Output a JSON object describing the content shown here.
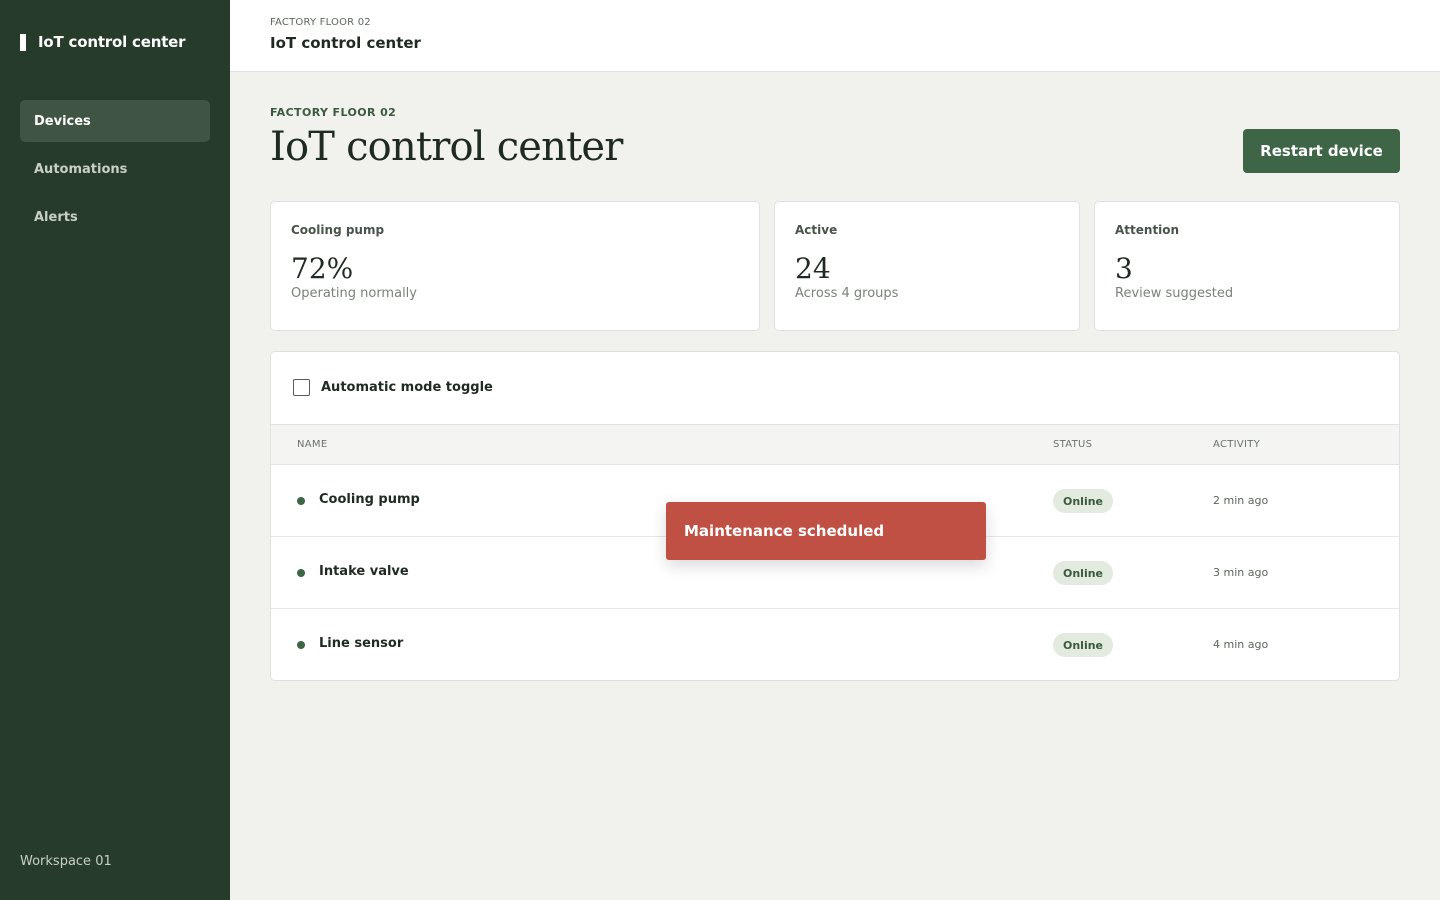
{
  "app": {
    "brand": "IoT control center",
    "workspace": "Workspace 01"
  },
  "sidebar": {
    "items": [
      {
        "label": "Devices",
        "active": true
      },
      {
        "label": "Automations",
        "active": false
      },
      {
        "label": "Alerts",
        "active": false
      }
    ]
  },
  "topbar": {
    "eyebrow": "FACTORY FLOOR 02",
    "title": "IoT control center"
  },
  "header": {
    "eyebrow": "FACTORY FLOOR 02",
    "title": "IoT control center",
    "primary_action": "Restart device"
  },
  "stats": [
    {
      "label": "Cooling pump",
      "value": "72%",
      "sub": "Operating normally"
    },
    {
      "label": "Active",
      "value": "24",
      "sub": "Across 4 groups"
    },
    {
      "label": "Attention",
      "value": "3",
      "sub": "Review suggested"
    }
  ],
  "panel": {
    "toggle_label": "Automatic mode toggle",
    "toggle_checked": false,
    "columns": [
      "NAME",
      "STATUS",
      "ACTIVITY"
    ],
    "rows": [
      {
        "name": "Cooling pump",
        "status": "Online",
        "activity": "2 min ago"
      },
      {
        "name": "Intake valve",
        "status": "Online",
        "activity": "3 min ago"
      },
      {
        "name": "Line sensor",
        "status": "Online",
        "activity": "4 min ago"
      }
    ]
  },
  "toast": {
    "message": "Maintenance scheduled"
  },
  "colors": {
    "sidebar_bg": "#263b2a",
    "accent": "#3d6546",
    "toast_bg": "#c04f44",
    "badge_bg": "#e3eadf"
  }
}
